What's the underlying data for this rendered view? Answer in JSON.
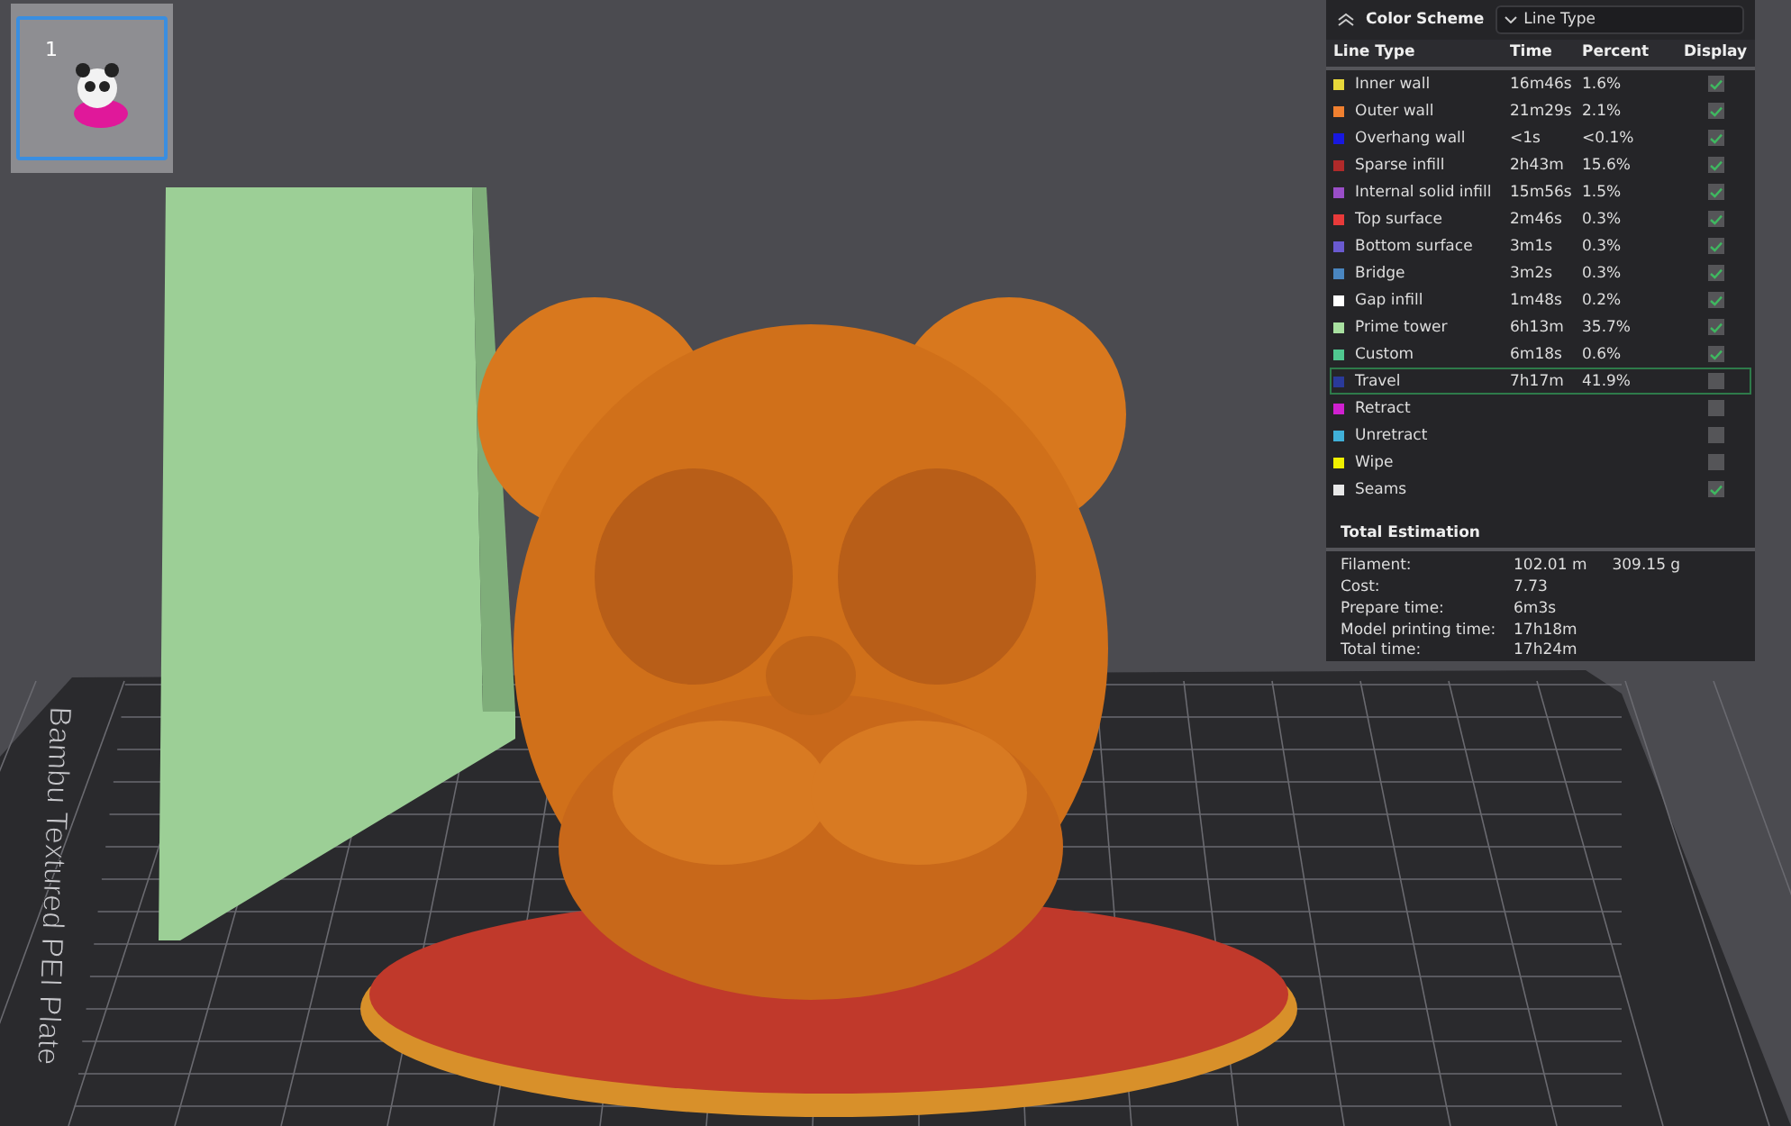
{
  "plate_thumbnail": {
    "label": "1",
    "selected": true
  },
  "bed_label": "Bambu Textured PEI Plate",
  "legend": {
    "title": "Color Scheme",
    "scheme": "Line Type",
    "columns": [
      "Line Type",
      "Time",
      "Percent",
      "Display"
    ],
    "rows": [
      {
        "name": "Inner wall",
        "color": "#e8d83a",
        "time": "16m46s",
        "percent": "1.6%",
        "checked": true,
        "selected": false
      },
      {
        "name": "Outer wall",
        "color": "#f08030",
        "time": "21m29s",
        "percent": "2.1%",
        "checked": true,
        "selected": false
      },
      {
        "name": "Overhang wall",
        "color": "#1818e0",
        "time": "<1s",
        "percent": "<0.1%",
        "checked": true,
        "selected": false
      },
      {
        "name": "Sparse infill",
        "color": "#b02a2a",
        "time": "2h43m",
        "percent": "15.6%",
        "checked": true,
        "selected": false
      },
      {
        "name": "Internal solid infill",
        "color": "#9a4ec8",
        "time": "15m56s",
        "percent": "1.5%",
        "checked": true,
        "selected": false
      },
      {
        "name": "Top surface",
        "color": "#e83a3a",
        "time": "2m46s",
        "percent": "0.3%",
        "checked": true,
        "selected": false
      },
      {
        "name": "Bottom surface",
        "color": "#6a5ad0",
        "time": "3m1s",
        "percent": "0.3%",
        "checked": true,
        "selected": false
      },
      {
        "name": "Bridge",
        "color": "#4a86c0",
        "time": "3m2s",
        "percent": "0.3%",
        "checked": true,
        "selected": false
      },
      {
        "name": "Gap infill",
        "color": "#ffffff",
        "time": "1m48s",
        "percent": "0.2%",
        "checked": true,
        "selected": false
      },
      {
        "name": "Prime tower",
        "color": "#a8e0a0",
        "time": "6h13m",
        "percent": "35.7%",
        "checked": true,
        "selected": false
      },
      {
        "name": "Custom",
        "color": "#50c890",
        "time": "6m18s",
        "percent": "0.6%",
        "checked": true,
        "selected": false
      },
      {
        "name": "Travel",
        "color": "#2a3a9a",
        "time": "7h17m",
        "percent": "41.9%",
        "checked": false,
        "selected": true
      },
      {
        "name": "Retract",
        "color": "#d020d0",
        "checked": false,
        "selected": false
      },
      {
        "name": "Unretract",
        "color": "#40b0d8",
        "checked": false,
        "selected": false
      },
      {
        "name": "Wipe",
        "color": "#f0f000",
        "checked": false,
        "selected": false
      },
      {
        "name": "Seams",
        "color": "#e8e8e8",
        "checked": true,
        "selected": false
      }
    ],
    "total_title": "Total Estimation",
    "totals": [
      {
        "label": "Filament:",
        "values": [
          "102.01 m",
          "309.15 g"
        ]
      },
      {
        "label": "Cost:",
        "values": [
          "7.73"
        ]
      },
      {
        "label": "Prepare time:",
        "values": [
          "6m3s"
        ]
      },
      {
        "label": "Model printing time:",
        "values": [
          "17h18m"
        ]
      },
      {
        "label": "Total time:",
        "values": [
          "17h24m"
        ]
      }
    ]
  }
}
